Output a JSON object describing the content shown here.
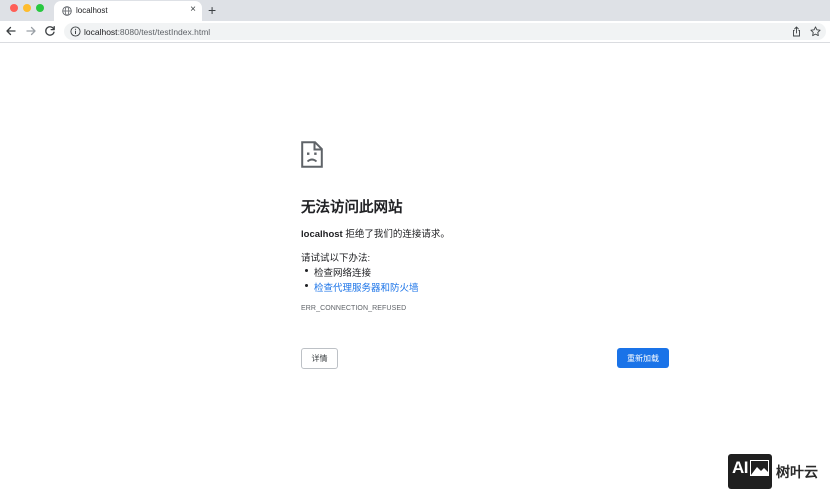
{
  "tab": {
    "title": "localhost",
    "close_glyph": "×",
    "new_tab_glyph": "+"
  },
  "toolbar": {
    "url_host": "localhost",
    "url_path": ":8080/test/testIndex.html",
    "icons": [
      "arrow-left-icon",
      "arrow-right-icon",
      "reload-icon",
      "info-icon",
      "share-icon",
      "star-icon"
    ]
  },
  "error": {
    "title": "无法访问此网站",
    "host": "localhost",
    "message": " 拒绝了我们的连接请求。",
    "suggestions_title": "请试试以下办法:",
    "suggestions": [
      "检查网络连接",
      "检查代理服务器和防火墙"
    ],
    "code": "ERR_CONNECTION_REFUSED",
    "details_label": "详情",
    "reload_label": "重新加载"
  },
  "watermark": {
    "logo_text": "AI",
    "text": "树叶云"
  },
  "colors": {
    "accent": "#1a73e8",
    "tabstrip": "#dee1e6",
    "omnibox": "#f1f3f4"
  }
}
